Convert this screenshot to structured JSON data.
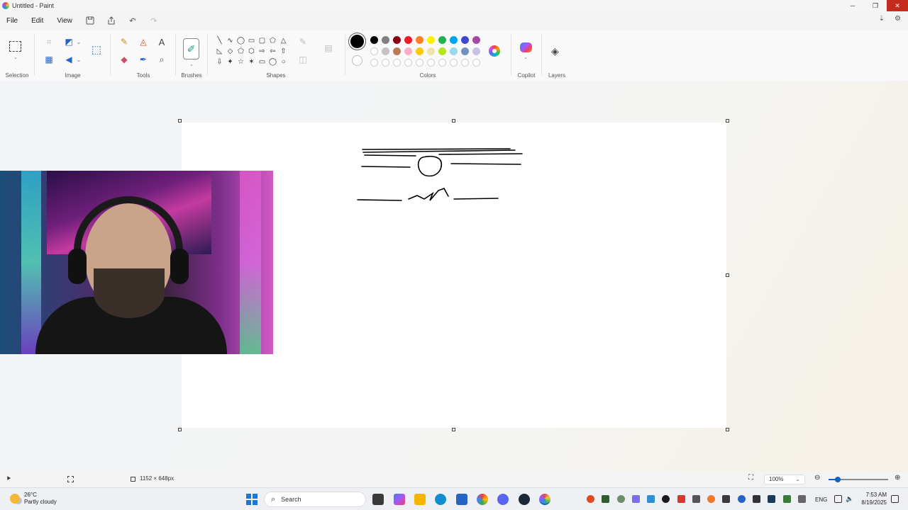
{
  "window": {
    "title": "Untitled - Paint"
  },
  "menu": {
    "file": "File",
    "edit": "Edit",
    "view": "View"
  },
  "ribbon": {
    "groups": {
      "selection": "Selection",
      "image": "Image",
      "tools": "Tools",
      "brushes": "Brushes",
      "shapes": "Shapes",
      "colors": "Colors",
      "copilot": "Copilot",
      "layers": "Layers"
    },
    "current_color": "#000000",
    "palette_row1": [
      "#000000",
      "#7f7f7f",
      "#880015",
      "#ed1c24",
      "#ff7f27",
      "#fff200",
      "#22b14c",
      "#00a2e8",
      "#3f48cc",
      "#a349a4"
    ],
    "palette_row2": [
      "",
      "#c3c3c3",
      "#b97a57",
      "#ffaec9",
      "#ffc90e",
      "#efe4b0",
      "#b5e61d",
      "#99d9ea",
      "#7092be",
      "#c8bfe7"
    ]
  },
  "status": {
    "canvas_size": "1152 × 648px",
    "zoom": "100%",
    "zoom_level": 0.15
  },
  "taskbar": {
    "weather_temp": "26°C",
    "weather_desc": "Partly cloudy",
    "search_placeholder": "Search",
    "language": "ENG",
    "time": "7:53 AM",
    "date": "8/19/2025"
  }
}
